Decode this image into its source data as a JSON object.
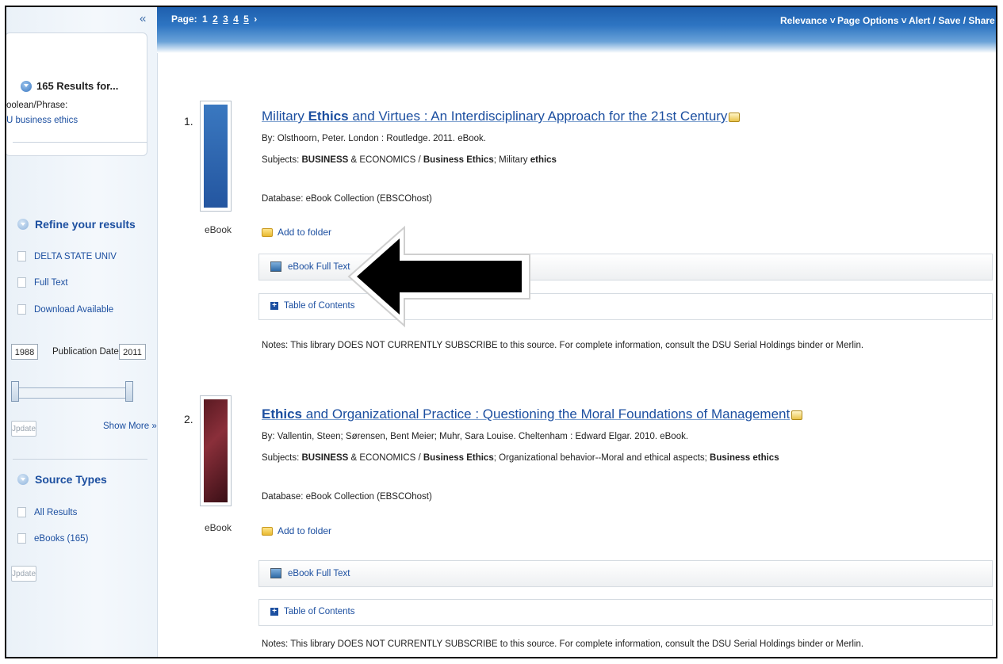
{
  "sidebar": {
    "collapse": "«",
    "results_count": "165 Results for...",
    "search_mode_label": "oolean/Phrase:",
    "search_terms": "U business ethics",
    "refine_heading": "Refine your results",
    "refine_checkboxes": [
      {
        "label": "DELTA STATE UNIV"
      },
      {
        "label": "Full Text"
      },
      {
        "label": "Download Available"
      }
    ],
    "pub_date": {
      "label": "Publication Date",
      "from": "1988",
      "to": "2011"
    },
    "update_label": "Jpdate",
    "show_more": "Show More »",
    "source_types_heading": "Source Types",
    "source_types": [
      {
        "label": "All Results"
      },
      {
        "label": "eBooks (165)"
      }
    ],
    "update_label_2": "Jpdate"
  },
  "topbar": {
    "page_label": "Page:",
    "pages": [
      "1",
      "2",
      "3",
      "4",
      "5"
    ],
    "next_glyph": "›",
    "relevance": "Relevance ˅",
    "page_options": "Page Options ˅",
    "alert_save_share": "Alert / Save / Share"
  },
  "results": [
    {
      "num": "1.",
      "type": "eBook",
      "title_pre": "Military ",
      "title_bold": "Ethics",
      "title_post": " and Virtues : An Interdisciplinary Approach for the 21st Century",
      "byline": "By: Olsthoorn, Peter. London : Routledge. 2011. eBook.",
      "subjects_prefix": "Subjects: ",
      "subjects_b1": "BUSINESS",
      "subjects_t1": " & ECONOMICS / ",
      "subjects_b2": "Business Ethics",
      "subjects_t2": "; Military ",
      "subjects_b3": "ethics",
      "subjects_t3": "",
      "database": "Database: eBook Collection (EBSCOhost)",
      "add_to_folder": "Add to folder",
      "full_text": "eBook Full Text",
      "toc": "Table of Contents",
      "notes": "Notes:  This library DOES NOT CURRENTLY SUBSCRIBE to this source. For complete information, consult the DSU Serial Holdings binder or Merlin."
    },
    {
      "num": "2.",
      "type": "eBook",
      "title_pre": "",
      "title_bold": "Ethics",
      "title_post": " and Organizational Practice : Questioning the Moral Foundations of Management",
      "byline": "By: Vallentin, Steen; Sørensen, Bent Meier; Muhr, Sara Louise. Cheltenham : Edward Elgar. 2010. eBook.",
      "subjects_prefix": "Subjects: ",
      "subjects_b1": "BUSINESS",
      "subjects_t1": " & ECONOMICS / ",
      "subjects_b2": "Business Ethics",
      "subjects_t2": "; Organizational behavior--Moral and ethical aspects; ",
      "subjects_b3": "Business ethics",
      "subjects_t3": "",
      "database": "Database: eBook Collection (EBSCOhost)",
      "add_to_folder": "Add to folder",
      "full_text": "eBook Full Text",
      "toc": "Table of Contents",
      "notes": "Notes:  This library DOES NOT CURRENTLY SUBSCRIBE to this source. For complete information, consult the DSU Serial Holdings binder or Merlin."
    }
  ],
  "colors": {
    "link": "#1c4fa0",
    "topbar": "#2e75c2",
    "arrow": "#000000"
  }
}
